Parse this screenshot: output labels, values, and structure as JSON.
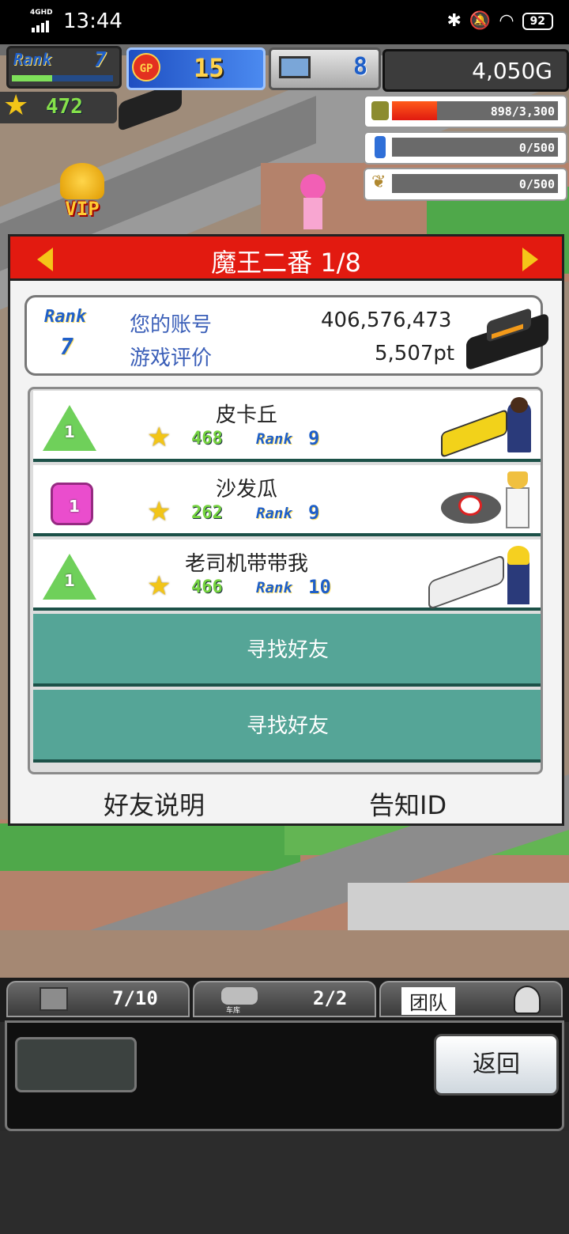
{
  "status_bar": {
    "network": "4GHD",
    "time": "13:44",
    "battery": "92"
  },
  "hud": {
    "rank_label": "Rank",
    "rank_value": "7",
    "gp_label": "GP",
    "gp_value": "15",
    "pc_value": "8",
    "gold": "4,050G",
    "stars": "472",
    "vip_label": "VIP",
    "bars": [
      {
        "icon": "coin-stack-icon",
        "value": "898/3,300",
        "fill": 0.27
      },
      {
        "icon": "fuel-bottle-icon",
        "value": "0/500",
        "fill": 0
      },
      {
        "icon": "wheat-icon",
        "value": "0/500",
        "fill": 0
      }
    ]
  },
  "modal": {
    "title": "魔王二番 1/8",
    "account": {
      "rank_label": "Rank",
      "rank_value": "7",
      "account_label": "您的账号",
      "account_value": "406,576,473",
      "rating_label": "游戏评价",
      "rating_value": "5,507pt"
    },
    "friends": [
      {
        "name": "皮卡丘",
        "badge": "1",
        "badge_shape": "triangle",
        "stars": "468",
        "rank_label": "Rank",
        "rank": "9"
      },
      {
        "name": "沙发瓜",
        "badge": "1",
        "badge_shape": "square",
        "stars": "262",
        "rank_label": "Rank",
        "rank": "9"
      },
      {
        "name": "老司机带带我",
        "badge": "1",
        "badge_shape": "triangle",
        "stars": "466",
        "rank_label": "Rank",
        "rank": "10"
      }
    ],
    "find_friend_buttons": [
      "寻找好友",
      "寻找好友"
    ],
    "footer": {
      "explain": "好友说明",
      "notify": "告知ID"
    }
  },
  "bottom_bar": {
    "tab1_value": "7/10",
    "tab2_label": "车库",
    "tab2_value": "2/2",
    "tab3_label": "团队",
    "back": "返回"
  }
}
